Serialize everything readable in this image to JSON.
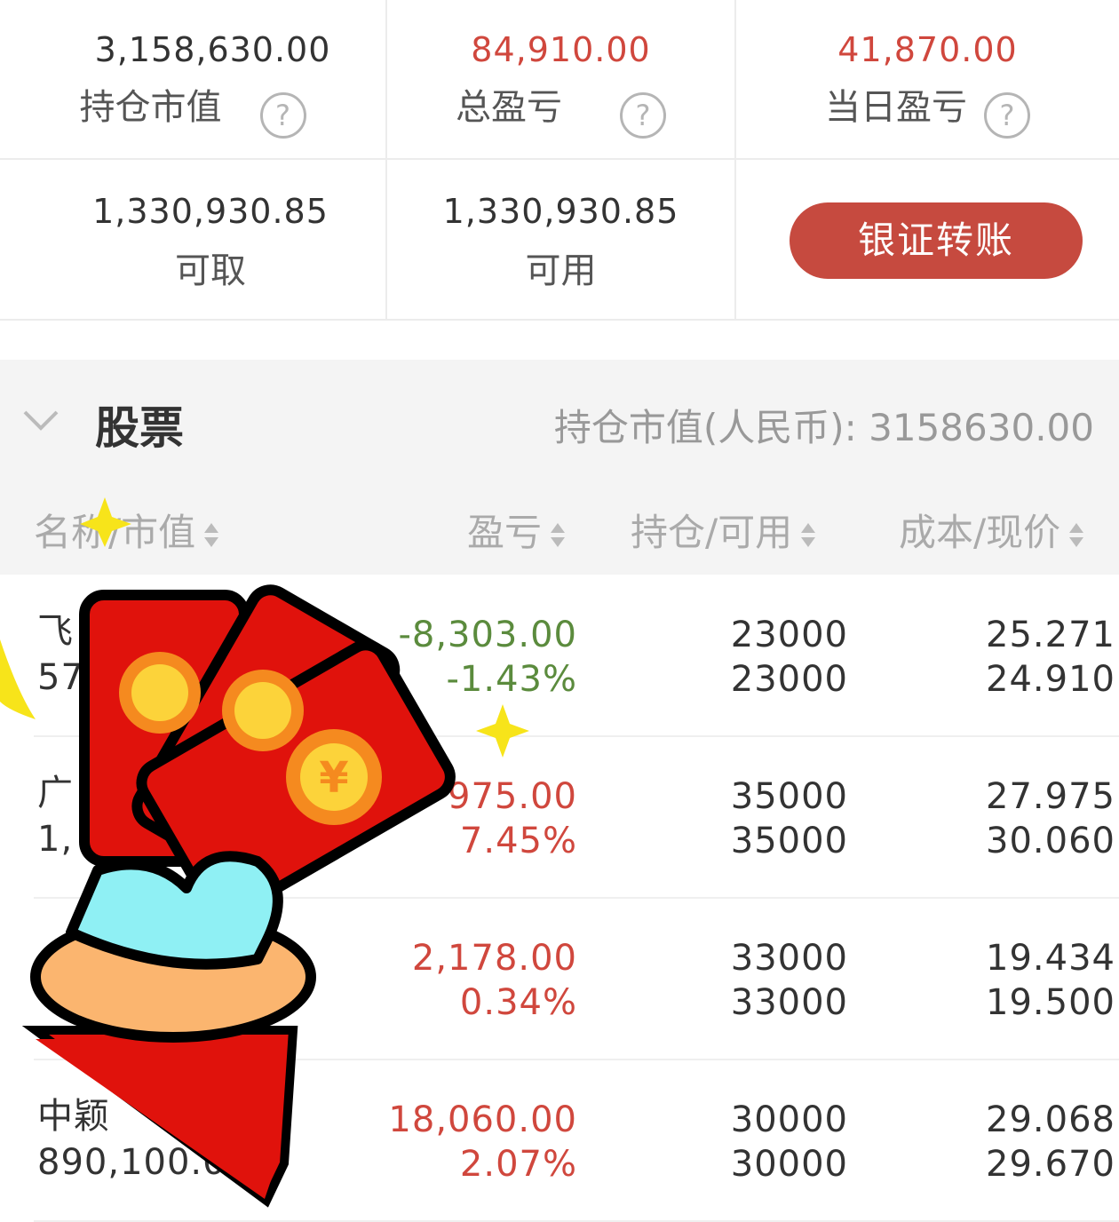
{
  "summary": {
    "holding_value": "3,158,630.00",
    "holding_value_label": "持仓市值",
    "total_pl": "84,910.00",
    "total_pl_label": "总盈亏",
    "daily_pl": "41,870.00",
    "daily_pl_label": "当日盈亏",
    "withdrawable": "1,330,930.85",
    "withdrawable_label": "可取",
    "available": "1,330,930.85",
    "available_label": "可用",
    "transfer_button": "银证转账",
    "help_glyph": "?"
  },
  "section": {
    "title": "股票",
    "total_label": "持仓市值(人民币):",
    "total_value": "3158630.00"
  },
  "columns": {
    "name": "名称/市值",
    "pl": "盈亏",
    "position": "持仓/可用",
    "cost": "成本/现价"
  },
  "rows": [
    {
      "name": "飞",
      "value": "57",
      "pl": "-8,303.00",
      "pl_pct": "-1.43%",
      "hold": "23000",
      "avail": "23000",
      "cost": "25.271",
      "price": "24.910",
      "tone": "green"
    },
    {
      "name": "广",
      "value": "1,",
      "pl": "975.00",
      "pl_pct": "7.45%",
      "hold": "35000",
      "avail": "35000",
      "cost": "27.975",
      "price": "30.060",
      "tone": "red"
    },
    {
      "name": "",
      "value": "",
      "pl": "2,178.00",
      "pl_pct": "0.34%",
      "hold": "33000",
      "avail": "33000",
      "cost": "19.434",
      "price": "19.500",
      "tone": "red"
    },
    {
      "name": "中颖",
      "value": "890,100.0",
      "pl": "18,060.00",
      "pl_pct": "2.07%",
      "hold": "30000",
      "avail": "30000",
      "cost": "29.068",
      "price": "29.670",
      "tone": "red"
    }
  ],
  "overlay": {
    "coin_glyph": "¥",
    "icon": "red-envelope-hand-icon"
  },
  "colors": {
    "accent": "#c64a3f",
    "up": "#d0473d",
    "down": "#5b8b3d"
  }
}
